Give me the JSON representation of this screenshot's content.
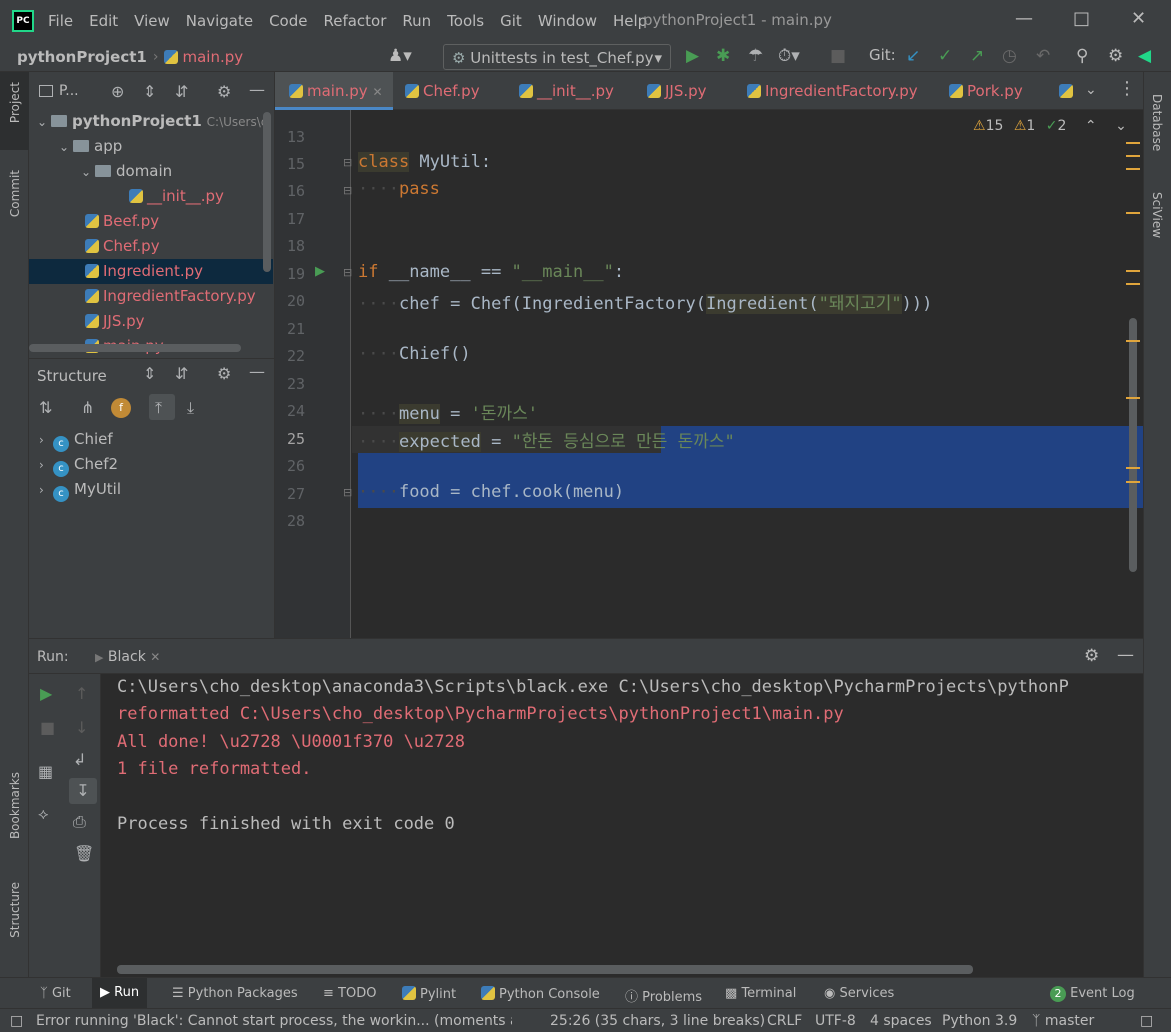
{
  "menubar": {
    "logo": "PC",
    "items": [
      "File",
      "Edit",
      "View",
      "Navigate",
      "Code",
      "Refactor",
      "Run",
      "Tools",
      "Git",
      "Window",
      "Help"
    ],
    "title": "pythonProject1 - main.py"
  },
  "navbar": {
    "project": "pythonProject1",
    "file": "main.py",
    "run_config": "Unittests in test_Chef.py",
    "git_label": "Git:"
  },
  "left_strip": {
    "project": "Project",
    "commit": "Commit",
    "bookmarks": "Bookmarks",
    "structure": "Structure"
  },
  "right_strip": {
    "database": "Database",
    "sciview": "SciView"
  },
  "project_panel": {
    "header": "P...",
    "root": "pythonProject1",
    "root_path": "C:\\Users\\c",
    "items": [
      {
        "label": "app"
      },
      {
        "label": "domain"
      },
      {
        "label": "__init__.py"
      },
      {
        "label": "Beef.py"
      },
      {
        "label": "Chef.py"
      },
      {
        "label": "Ingredient.py"
      },
      {
        "label": "IngredientFactory.py"
      },
      {
        "label": "JJS.py"
      },
      {
        "label": "main.py"
      }
    ]
  },
  "structure_panel": {
    "title": "Structure",
    "items": [
      "Chief",
      "Chef2",
      "MyUtil"
    ]
  },
  "tabs": [
    "main.py",
    "Chef.py",
    "__init__.py",
    "JJS.py",
    "IngredientFactory.py",
    "Pork.py"
  ],
  "inspections": {
    "warnings": "15",
    "weak": "1",
    "ok": "2"
  },
  "code": {
    "lines": [
      "13",
      "15",
      "16",
      "17",
      "18",
      "19",
      "20",
      "21",
      "22",
      "23",
      "24",
      "25",
      "26",
      "27",
      "28"
    ],
    "l15_kw": "class",
    "l15_rest": " MyUtil:",
    "l16": "pass",
    "l19_kw": "if",
    "l19_a": " __name__ == ",
    "l19_str": "\"__main__\"",
    "l19_b": ":",
    "l20_a": "chef = Chef(IngredientFactory(",
    "l20_b": "Ingredient(",
    "l20_str": "\"돼지고기\"",
    "l20_c": ")))",
    "l22": "Chief()",
    "l24_a": "menu",
    "l24_b": " = ",
    "l24_str": "'돈까스'",
    "l25_a": "expected",
    "l25_b": " = ",
    "l25_str": "\"한돈 등심으로 만든 돈까스\"",
    "l27": "food = chef.cook(menu)"
  },
  "run_panel": {
    "label": "Run:",
    "tab": "Black",
    "output": [
      "C:\\Users\\cho_desktop\\anaconda3\\Scripts\\black.exe C:\\Users\\cho_desktop\\PycharmProjects\\pythonP",
      "reformatted C:\\Users\\cho_desktop\\PycharmProjects\\pythonProject1\\main.py",
      "All done! \\u2728 \\U0001f370 \\u2728",
      "1 file reformatted.",
      "",
      "Process finished with exit code 0"
    ]
  },
  "bottom_tools": [
    "Git",
    "Run",
    "Python Packages",
    "TODO",
    "Pylint",
    "Python Console",
    "Problems",
    "Terminal",
    "Services",
    "Event Log"
  ],
  "event_log_count": "2",
  "status": {
    "message": "Error running 'Black': Cannot start process, the workin... (moments agc",
    "position": "25:26 (35 chars, 3 line breaks)",
    "line_sep": "CRLF",
    "encoding": "UTF-8",
    "indent": "4 spaces",
    "interpreter": "Python 3.9",
    "branch": "master"
  },
  "colors": {
    "accent": "#4a88c7",
    "selection": "#214283",
    "error_text": "#e06c75",
    "run_green": "#499c54"
  }
}
